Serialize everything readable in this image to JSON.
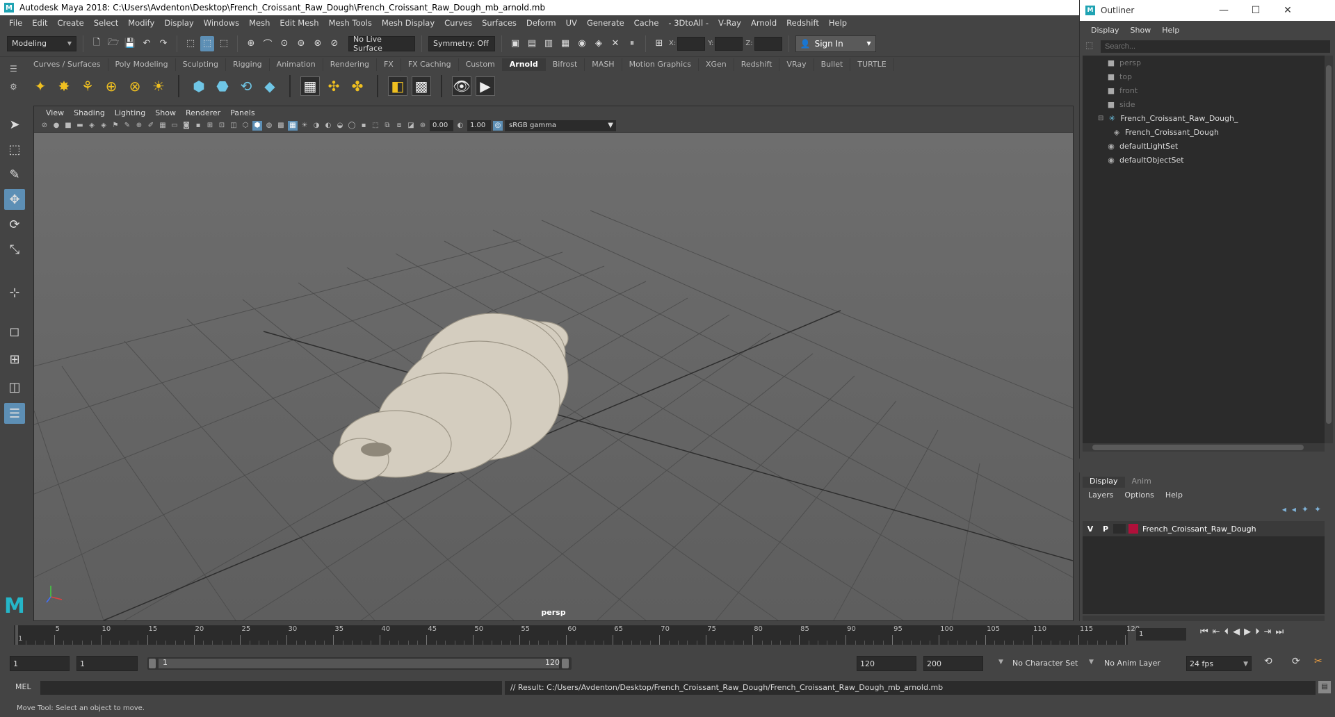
{
  "window": {
    "title": "Autodesk Maya 2018: C:\\Users\\Avdenton\\Desktop\\French_Croissant_Raw_Dough\\French_Croissant_Raw_Dough_mb_arnold.mb",
    "icon": "maya-icon"
  },
  "menubar": {
    "items": [
      "File",
      "Edit",
      "Create",
      "Select",
      "Modify",
      "Display",
      "Windows",
      "Mesh",
      "Edit Mesh",
      "Mesh Tools",
      "Mesh Display",
      "Curves",
      "Surfaces",
      "Deform",
      "UV",
      "Generate",
      "Cache",
      "- 3DtoAll -",
      "V-Ray",
      "Arnold",
      "Redshift",
      "Help"
    ]
  },
  "statusline": {
    "menu_set": "Modeling",
    "live_surface": "No Live Surface",
    "symmetry": "Symmetry: Off",
    "x_label": "X:",
    "y_label": "Y:",
    "z_label": "Z:",
    "sign_in": "Sign In"
  },
  "shelf": {
    "tabs": [
      "Curves / Surfaces",
      "Poly Modeling",
      "Sculpting",
      "Rigging",
      "Animation",
      "Rendering",
      "FX",
      "FX Caching",
      "Custom",
      "Arnold",
      "Bifrost",
      "MASH",
      "Motion Graphics",
      "XGen",
      "Redshift",
      "VRay",
      "Bullet",
      "TURTLE"
    ],
    "active_tab": "Arnold"
  },
  "viewport": {
    "menu": [
      "View",
      "Shading",
      "Lighting",
      "Show",
      "Renderer",
      "Panels"
    ],
    "exposure": "0.00",
    "gamma_value": "1.00",
    "color_space": "sRGB gamma",
    "camera_label": "persp",
    "mesh_color": "#d4cdbf"
  },
  "outliner": {
    "title": "Outliner",
    "menu": [
      "Display",
      "Show",
      "Help"
    ],
    "search_placeholder": "Search...",
    "items": [
      {
        "label": "persp",
        "icon": "camera-icon"
      },
      {
        "label": "top",
        "icon": "camera-icon"
      },
      {
        "label": "front",
        "icon": "camera-icon"
      },
      {
        "label": "side",
        "icon": "camera-icon"
      },
      {
        "label": "French_Croissant_Raw_Dough_",
        "icon": "group-icon"
      },
      {
        "label": "French_Croissant_Dough",
        "icon": "mesh-icon"
      },
      {
        "label": "defaultLightSet",
        "icon": "set-icon"
      },
      {
        "label": "defaultObjectSet",
        "icon": "set-icon"
      }
    ]
  },
  "layer_editor": {
    "tabs": [
      "Display",
      "Anim"
    ],
    "menu": [
      "Layers",
      "Options",
      "Help"
    ],
    "layer": {
      "v": "V",
      "p": "P",
      "name": "French_Croissant_Raw_Dough",
      "color": "#b0103a"
    }
  },
  "timeline": {
    "start_marker": "1",
    "labels": [
      "1",
      "5",
      "10",
      "15",
      "20",
      "25",
      "30",
      "35",
      "40",
      "45",
      "50",
      "55",
      "60",
      "65",
      "70",
      "75",
      "80",
      "85",
      "90",
      "95",
      "100",
      "105",
      "110",
      "115",
      "120"
    ],
    "current_frame": "1"
  },
  "range": {
    "start": "1",
    "inner_start": "1",
    "slider_start": "1",
    "slider_end": "120",
    "end": "120",
    "anim_end": "200",
    "character_set": "No Character Set",
    "anim_layer": "No Anim Layer",
    "fps": "24 fps"
  },
  "commandline": {
    "label": "MEL",
    "result": "// Result: C:/Users/Avdenton/Desktop/French_Croissant_Raw_Dough/French_Croissant_Raw_Dough_mb_arnold.mb"
  },
  "helpline": {
    "text": "Move Tool: Select an object to move."
  }
}
